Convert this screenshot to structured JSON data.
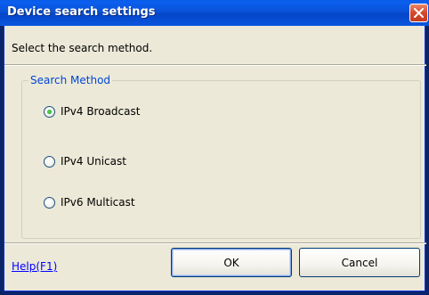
{
  "window": {
    "title": "Device search settings"
  },
  "dialog": {
    "instruction": "Select the search method.",
    "group_label": "Search Method",
    "options": [
      {
        "label": "IPv4 Broadcast",
        "checked": true
      },
      {
        "label": "IPv4 Unicast",
        "checked": false
      },
      {
        "label": "IPv6 Multicast",
        "checked": false
      }
    ],
    "help_link": "Help(F1)",
    "ok_label": "OK",
    "cancel_label": "Cancel"
  },
  "colors": {
    "titlebar": "#0a52d7",
    "close_button": "#d6472a",
    "group_label": "#0046d5",
    "link": "#0000ff",
    "radio_selected": "#21a121"
  },
  "icons": {
    "close": "close-icon"
  }
}
